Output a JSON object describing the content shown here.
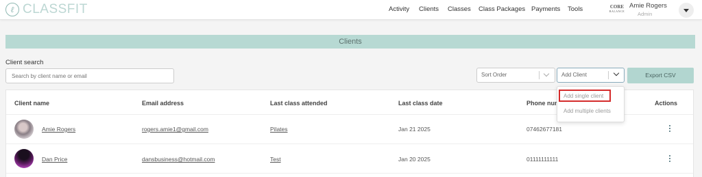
{
  "app": {
    "logo_text": "CLASSFIT",
    "logo_mark": "ℓ"
  },
  "nav": {
    "items": [
      "Activity",
      "Clients",
      "Classes",
      "Class Packages",
      "Payments",
      "Tools"
    ]
  },
  "brand": {
    "name": "CORE",
    "tagline": "BALANCE"
  },
  "user": {
    "name": "Amie Rogers",
    "role": "Admin",
    "menu_icon": "caret-down-icon"
  },
  "banner": {
    "title": "Clients"
  },
  "search": {
    "label": "Client search",
    "placeholder": "Search by client name or email"
  },
  "controls": {
    "sort_placeholder": "Sort Order",
    "add_client_label": "Add Client",
    "export_label": "Export CSV"
  },
  "add_client_menu": {
    "items": [
      "Add single client",
      "Add multiple clients"
    ],
    "highlight_color": "#d42a2a"
  },
  "table": {
    "headers": [
      "Client name",
      "Email address",
      "Last class attended",
      "Last class date",
      "Phone num",
      "Actions"
    ],
    "rows": [
      {
        "name": "Amie Rogers",
        "email": "rogers.amie1@gmail.com",
        "last_class": "Pilates",
        "last_date": "Jan 21 2025",
        "phone": "07462677181"
      },
      {
        "name": "Dan Price",
        "email": "dansbusiness@hotmail.com",
        "last_class": "Test",
        "last_date": "Jan 20 2025",
        "phone": "01111111111"
      }
    ]
  },
  "colors": {
    "accent": "#b7d9d3",
    "accent_text": "#5b6f6c",
    "action_icon": "#3d6670"
  }
}
